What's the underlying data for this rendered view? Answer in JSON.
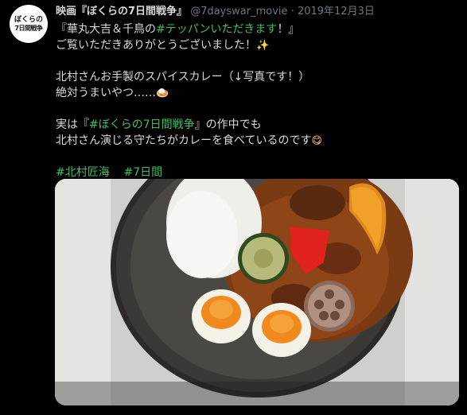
{
  "tweet": {
    "avatar_text_line1": "ぼくらの",
    "avatar_text_line2": "7日間戦争",
    "author_name": "映画『ぼくらの7日間戦争』",
    "handle": "@7dayswar_movie",
    "separator": "·",
    "date": "2019年12月3日",
    "line1_prefix": "『華丸大吉＆千鳥の",
    "line1_hashtag": "#テッパンいただきます",
    "line1_suffix": "！』",
    "line2": "ご覧いただきありがとうございました！",
    "line2_emoji": "✨",
    "line3": "北村さんお手製のスパイスカレー（↓写真です！）",
    "line4": "絶対うまいやつ……",
    "line4_emoji": "🍛",
    "line5_prefix": "実は『",
    "line5_hashtag": "#ぼくらの7日間戦争",
    "line5_suffix": "』の作中でも",
    "line6": "北村さん演じる守たちがカレーを食べているのです",
    "line6_emoji": "😋",
    "hashtag1": "#北村匠海",
    "hashtag2": "#7日間"
  },
  "colors": {
    "background": "#000000",
    "text": "#d9d9d9",
    "meta": "#6e767d",
    "link": "#1d9bf0",
    "hashtag": "#3fbf6a"
  },
  "photo": {
    "subject": "spice curry with rice, grilled vegetables and boiled eggs on a dark plate"
  }
}
